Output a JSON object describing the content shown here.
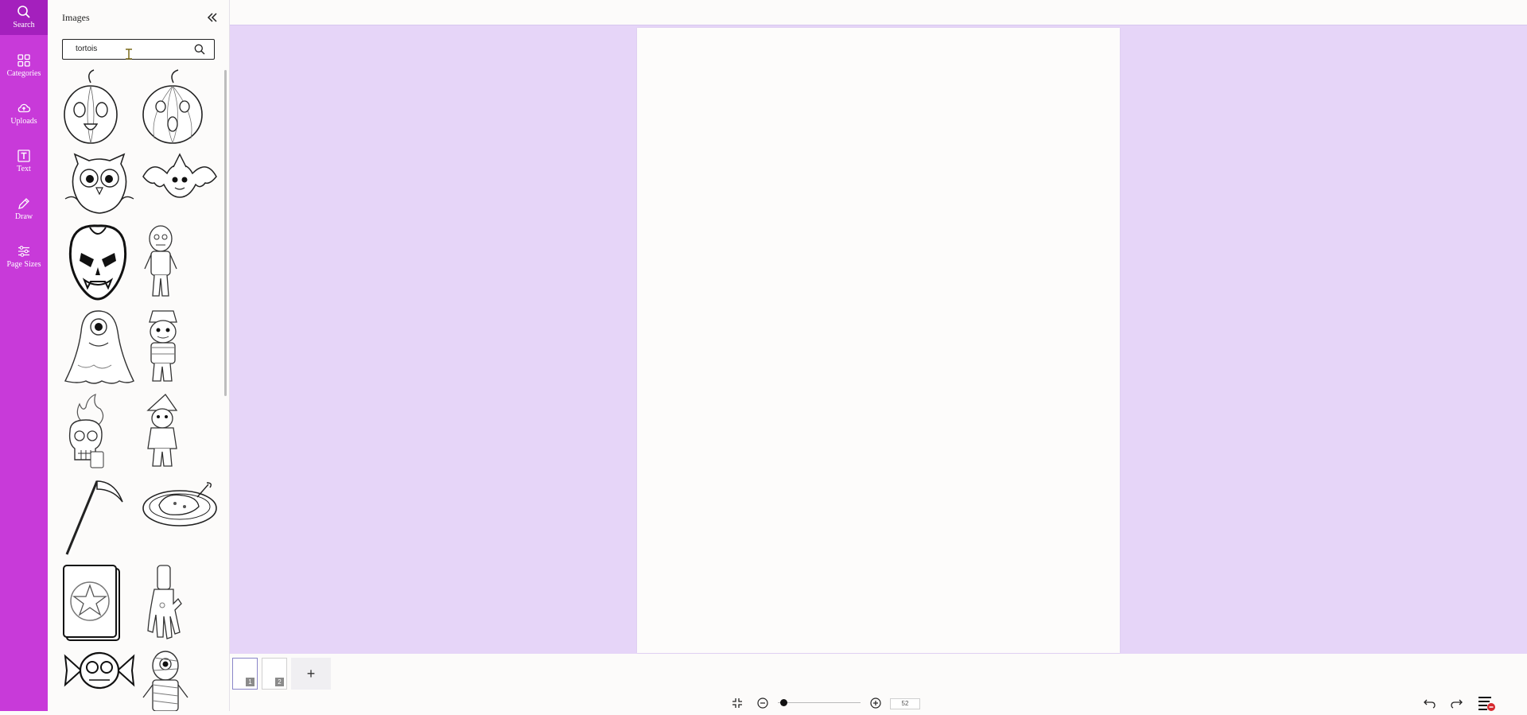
{
  "sidebar": {
    "items": [
      {
        "label": "Search",
        "icon": "search-icon"
      },
      {
        "label": "Categories",
        "icon": "grid-icon"
      },
      {
        "label": "Uploads",
        "icon": "cloud-upload-icon"
      },
      {
        "label": "Text",
        "icon": "text-icon"
      },
      {
        "label": "Draw",
        "icon": "pencil-icon"
      },
      {
        "label": "Page Sizes",
        "icon": "sliders-icon"
      }
    ],
    "active_index": 0,
    "color": "#c83ad9"
  },
  "panel": {
    "title": "Images",
    "search_value": "tortois",
    "images": [
      {
        "icon": "pumpkin-icon"
      },
      {
        "icon": "pumpkin-icon"
      },
      {
        "icon": "owl-icon"
      },
      {
        "icon": "bat-icon"
      },
      {
        "icon": "vampire-face-icon"
      },
      {
        "icon": "zombie-icon"
      },
      {
        "icon": "cyclops-ghost-icon"
      },
      {
        "icon": "pirate-kid-icon"
      },
      {
        "icon": "flaming-skull-icon"
      },
      {
        "icon": "witch-kid-icon"
      },
      {
        "icon": "scythe-icon"
      },
      {
        "icon": "roast-platter-icon"
      },
      {
        "icon": "tarot-card-icon"
      },
      {
        "icon": "zombie-hand-icon"
      },
      {
        "icon": "skull-candy-icon"
      },
      {
        "icon": "mummy-icon"
      }
    ]
  },
  "canvas": {
    "background": "#e6d5f8"
  },
  "pages": [
    {
      "number": "1",
      "active": true
    },
    {
      "number": "2",
      "active": false
    }
  ],
  "add_page_label": "+",
  "zoom": {
    "value": "52",
    "level": 0.05
  }
}
